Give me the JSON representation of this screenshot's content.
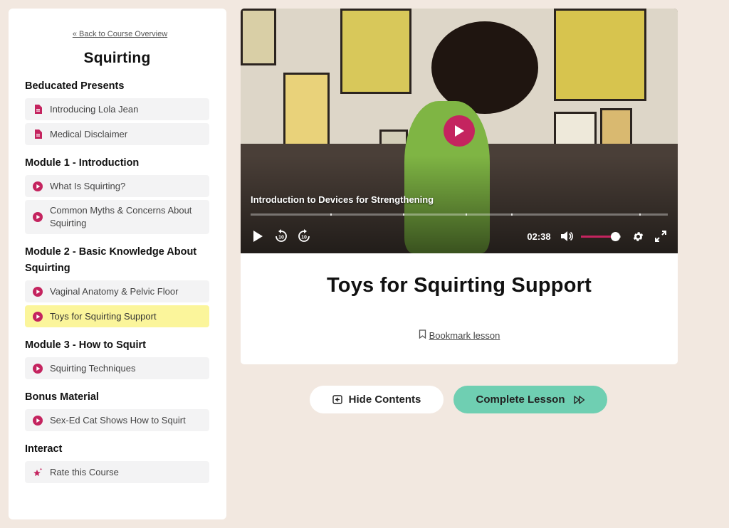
{
  "sidebar": {
    "back_link": "« Back to Course Overview",
    "course_title": "Squirting",
    "sections": [
      {
        "heading": "Beducated Presents",
        "items": [
          {
            "label": "Introducing Lola Jean",
            "icon": "document-icon"
          },
          {
            "label": "Medical Disclaimer",
            "icon": "document-icon"
          }
        ]
      },
      {
        "heading": "Module 1 - Introduction",
        "items": [
          {
            "label": "What Is Squirting?",
            "icon": "play-circle-icon"
          },
          {
            "label": "Common Myths & Concerns About Squirting",
            "icon": "play-circle-icon"
          }
        ]
      },
      {
        "heading": "Module 2 - Basic Knowledge About Squirting",
        "items": [
          {
            "label": "Vaginal Anatomy & Pelvic Floor",
            "icon": "play-circle-icon"
          },
          {
            "label": "Toys for Squirting Support",
            "icon": "play-circle-icon",
            "active": true
          }
        ]
      },
      {
        "heading": "Module 3 - How to Squirt",
        "items": [
          {
            "label": "Squirting Techniques",
            "icon": "play-circle-icon"
          }
        ]
      },
      {
        "heading": "Bonus Material",
        "items": [
          {
            "label": "Sex-Ed Cat Shows How to Squirt",
            "icon": "play-circle-icon"
          }
        ]
      },
      {
        "heading": "Interact",
        "items": [
          {
            "label": "Rate this Course",
            "icon": "star-sparkle-icon"
          }
        ]
      }
    ]
  },
  "video": {
    "caption": "Introduction to Devices for Strengthening",
    "time": "02:38",
    "volume_level": 0.85,
    "icons": [
      "play-icon",
      "rewind-10-icon",
      "forward-10-icon",
      "volume-icon",
      "settings-icon",
      "fullscreen-icon"
    ]
  },
  "lesson": {
    "title": "Toys for Squirting Support",
    "bookmark_label": "Bookmark lesson"
  },
  "buttons": {
    "hide_contents": "Hide Contents",
    "complete_lesson": "Complete Lesson"
  },
  "colors": {
    "background": "#f2e8e0",
    "accent": "#c4245f",
    "active_item": "#fbf59b",
    "complete_button": "#6fcfb2"
  }
}
